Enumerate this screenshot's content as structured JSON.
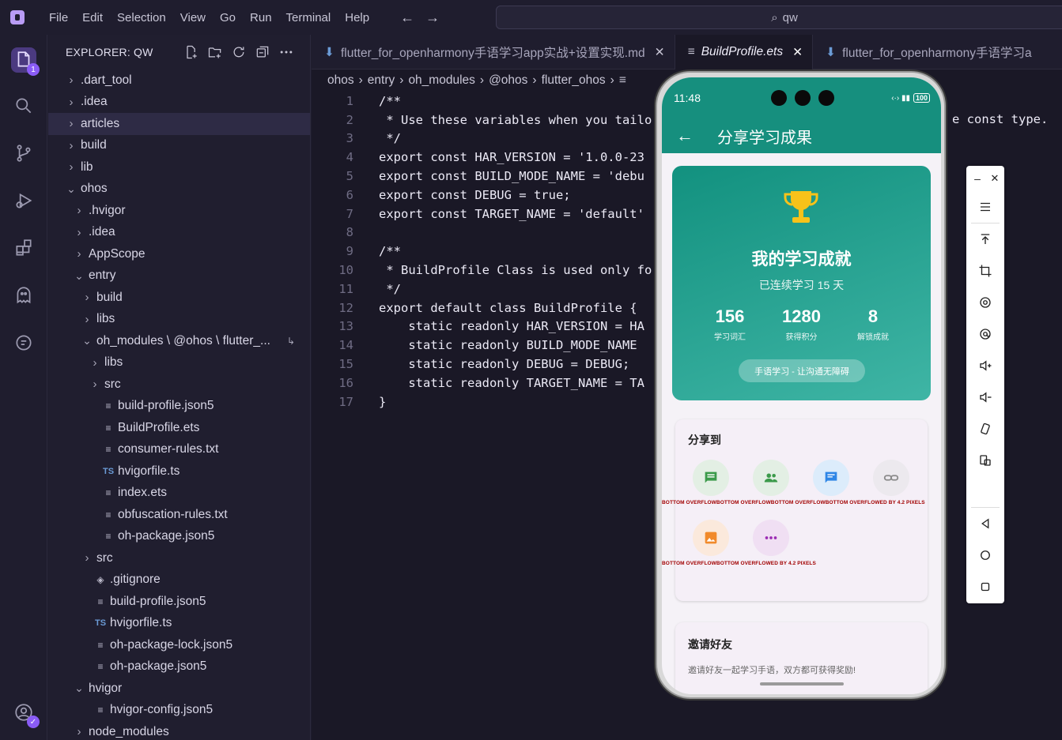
{
  "menu": [
    "File",
    "Edit",
    "Selection",
    "View",
    "Go",
    "Run",
    "Terminal",
    "Help"
  ],
  "command_center": {
    "label": "qw"
  },
  "activity_badge": "1",
  "explorer": {
    "title": "EXPLORER: QW",
    "tree": [
      {
        "label": ".dart_tool",
        "depth": 0,
        "kind": "folder",
        "open": false
      },
      {
        "label": ".idea",
        "depth": 0,
        "kind": "folder",
        "open": false
      },
      {
        "label": "articles",
        "depth": 0,
        "kind": "folder",
        "open": false,
        "selected": true
      },
      {
        "label": "build",
        "depth": 0,
        "kind": "folder",
        "open": false
      },
      {
        "label": "lib",
        "depth": 0,
        "kind": "folder",
        "open": false
      },
      {
        "label": "ohos",
        "depth": 0,
        "kind": "folder",
        "open": true
      },
      {
        "label": ".hvigor",
        "depth": 1,
        "kind": "folder",
        "open": false
      },
      {
        "label": ".idea",
        "depth": 1,
        "kind": "folder",
        "open": false
      },
      {
        "label": "AppScope",
        "depth": 1,
        "kind": "folder",
        "open": false
      },
      {
        "label": "entry",
        "depth": 1,
        "kind": "folder",
        "open": true
      },
      {
        "label": "build",
        "depth": 2,
        "kind": "folder",
        "open": false
      },
      {
        "label": "libs",
        "depth": 2,
        "kind": "folder",
        "open": false
      },
      {
        "label": "oh_modules \\ @ohos \\ flutter_...",
        "depth": 2,
        "kind": "folder",
        "open": true
      },
      {
        "label": "libs",
        "depth": 3,
        "kind": "folder",
        "open": false
      },
      {
        "label": "src",
        "depth": 3,
        "kind": "folder",
        "open": false
      },
      {
        "label": "build-profile.json5",
        "depth": 3,
        "kind": "file"
      },
      {
        "label": "BuildProfile.ets",
        "depth": 3,
        "kind": "file"
      },
      {
        "label": "consumer-rules.txt",
        "depth": 3,
        "kind": "file"
      },
      {
        "label": "hvigorfile.ts",
        "depth": 3,
        "kind": "ts"
      },
      {
        "label": "index.ets",
        "depth": 3,
        "kind": "file"
      },
      {
        "label": "obfuscation-rules.txt",
        "depth": 3,
        "kind": "file"
      },
      {
        "label": "oh-package.json5",
        "depth": 3,
        "kind": "file"
      },
      {
        "label": "src",
        "depth": 2,
        "kind": "folder",
        "open": false
      },
      {
        "label": ".gitignore",
        "depth": 2,
        "kind": "git"
      },
      {
        "label": "build-profile.json5",
        "depth": 2,
        "kind": "file"
      },
      {
        "label": "hvigorfile.ts",
        "depth": 2,
        "kind": "ts"
      },
      {
        "label": "oh-package-lock.json5",
        "depth": 2,
        "kind": "file"
      },
      {
        "label": "oh-package.json5",
        "depth": 2,
        "kind": "file"
      },
      {
        "label": "hvigor",
        "depth": 1,
        "kind": "folder",
        "open": true
      },
      {
        "label": "hvigor-config.json5",
        "depth": 2,
        "kind": "file"
      },
      {
        "label": "node_modules",
        "depth": 1,
        "kind": "folder",
        "open": false
      }
    ]
  },
  "tabs": [
    {
      "label": "flutter_for_openharmony手语学习app实战+设置实现.md",
      "active": false
    },
    {
      "label": "BuildProfile.ets",
      "active": true
    },
    {
      "label": "flutter_for_openharmony手语学习a",
      "active": false
    }
  ],
  "breadcrumb": [
    "ohos",
    "entry",
    "oh_modules",
    "@ohos",
    "flutter_ohos"
  ],
  "code_lines": [
    "/**",
    " * Use these variables when you tailo",
    " */",
    "export const HAR_VERSION = '1.0.0-23",
    "export const BUILD_MODE_NAME = 'debu",
    "export const DEBUG = true;",
    "export const TARGET_NAME = 'default'",
    "",
    "/**",
    " * BuildProfile Class is used only fo",
    " */",
    "export default class BuildProfile {",
    "    static readonly HAR_VERSION = HA",
    "    static readonly BUILD_MODE_NAME",
    "    static readonly DEBUG = DEBUG;",
    "    static readonly TARGET_NAME = TA",
    "}"
  ],
  "code_overflow_text": "e const type.",
  "phone": {
    "time": "11:48",
    "battery": "100",
    "page_title": "分享学习成果",
    "hero": {
      "title": "我的学习成就",
      "subtitle": "已连续学习 15 天",
      "stats": [
        {
          "value": "156",
          "label": "学习词汇"
        },
        {
          "value": "1280",
          "label": "获得积分"
        },
        {
          "value": "8",
          "label": "解锁成就"
        }
      ],
      "tagline": "手语学习 - 让沟通无障碍"
    },
    "share_title": "分享到",
    "share_icons": [
      {
        "icon": "message-icon",
        "bg": "#e3efe4",
        "fg": "#3b9a4a"
      },
      {
        "icon": "people-icon",
        "bg": "#e3efe4",
        "fg": "#3b9a4a"
      },
      {
        "icon": "chat-icon",
        "bg": "#dcecfb",
        "fg": "#2f86e6"
      },
      {
        "icon": "link-icon",
        "bg": "#ece9ee",
        "fg": "#8a8a8a"
      },
      {
        "icon": "image-icon",
        "bg": "#fbe9dc",
        "fg": "#f18a2b"
      },
      {
        "icon": "more-icon",
        "bg": "#f0dff3",
        "fg": "#9b2ab3"
      }
    ],
    "overflow_row1": "BOTTOM OVERFLOWBOTTOM OVERFLOWBOTTOM OVERFLOWBOTTOM OVERFLOWED BY 4.2 PIXELS",
    "overflow_row2": "BOTTOM OVERFLOWBOTTOM OVERFLOWED BY 4.2 PIXELS",
    "invite_title": "邀请好友",
    "invite_text": "邀请好友一起学习手语，双方都可获得奖励!"
  },
  "colors": {
    "accent": "#8a5cf6",
    "app_teal": "#168f7e",
    "trophy": "#f7c21a"
  }
}
